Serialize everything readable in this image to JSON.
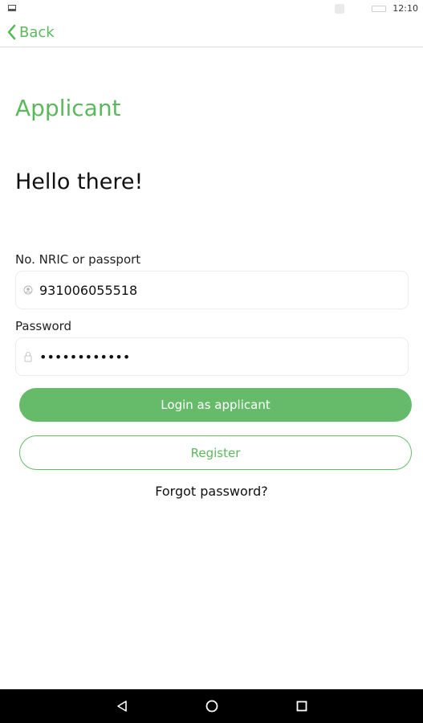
{
  "status_bar": {
    "time": "12:10"
  },
  "nav": {
    "back_label": "Back"
  },
  "page": {
    "section_title": "Applicant",
    "greeting": "Hello there!"
  },
  "form": {
    "id_label": "No. NRIC or passport",
    "id_value": "931006055518",
    "password_label": "Password",
    "password_value": "abcdefghijkl"
  },
  "actions": {
    "login_label": "Login as applicant",
    "register_label": "Register",
    "forgot_label": "Forgot password?"
  },
  "theme": {
    "accent": "#66bb6a"
  },
  "icons": {
    "back": "chevron-left-icon",
    "id_field": "user-icon",
    "password_field": "lock-icon",
    "nav_back": "triangle-back-icon",
    "nav_home": "circle-home-icon",
    "nav_recents": "square-recents-icon"
  }
}
